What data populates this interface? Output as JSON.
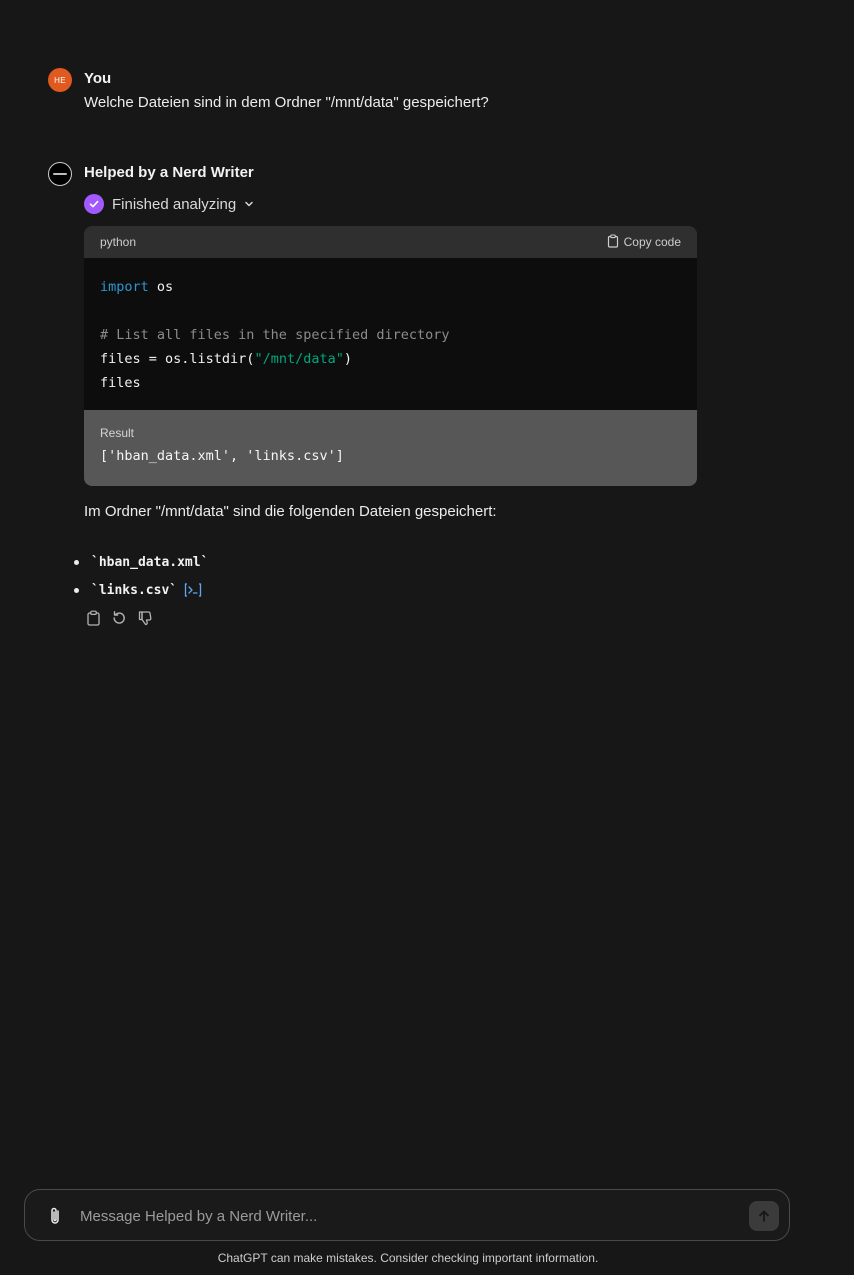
{
  "conversation": {
    "user": {
      "avatar_initials": "HE",
      "avatar_color": "#e0591f",
      "name": "You",
      "message": "Welche Dateien sind in dem Ordner \"/mnt/data\" gespeichert?"
    },
    "assistant": {
      "name": "Helped by a Nerd Writer",
      "status": "Finished analyzing",
      "status_color": "#a259ff",
      "code_block": {
        "language": "python",
        "copy_label": "Copy code",
        "lines": {
          "l1_keyword": "import",
          "l1_rest": " os",
          "l3_comment": "# List all files in the specified directory",
          "l4_pre": "files = os.listdir(",
          "l4_string": "\"/mnt/data\"",
          "l4_post": ")",
          "l5": "files"
        },
        "result_label": "Result",
        "result_value": "['hban_data.xml', 'links.csv']"
      },
      "answer_text": "Im Ordner \"/mnt/data\" sind die folgenden Dateien gespeichert:",
      "files": [
        "`hban_data.xml`",
        "`links.csv`"
      ]
    }
  },
  "icons": {
    "check": "check-icon",
    "chevron": "chevron-down-icon",
    "copy": "clipboard-icon",
    "view_code": "code-link-icon",
    "regenerate": "refresh-icon",
    "dislike": "thumbs-down-icon",
    "attach": "paperclip-icon",
    "send": "arrow-up-icon"
  },
  "composer": {
    "placeholder": "Message Helped by a Nerd Writer..."
  },
  "footer": {
    "disclaimer": "ChatGPT can make mistakes. Consider checking important information."
  }
}
